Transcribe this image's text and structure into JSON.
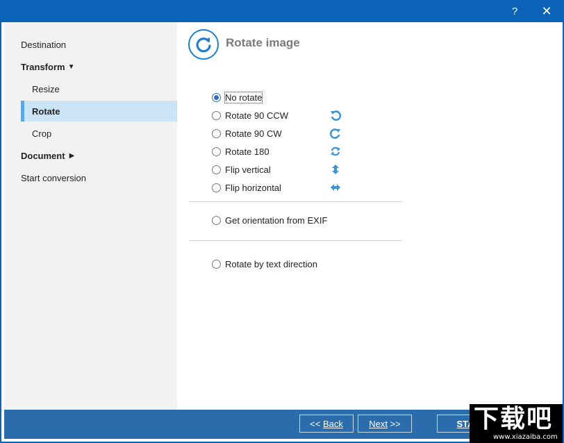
{
  "titlebar": {
    "help_glyph": "?",
    "close_glyph": "✕"
  },
  "sidebar": {
    "items": [
      {
        "label": "Destination",
        "bold": false
      },
      {
        "label": "Transform",
        "bold": true,
        "caret": "down"
      },
      {
        "label": "Resize",
        "sub": true
      },
      {
        "label": "Rotate",
        "sub": true,
        "active": true
      },
      {
        "label": "Crop",
        "sub": true
      },
      {
        "label": "Document",
        "bold": true,
        "caret": "right"
      },
      {
        "label": "Start conversion",
        "bold": false
      }
    ]
  },
  "header": {
    "title": "Rotate image",
    "icon": "rotate-cw-icon"
  },
  "options": [
    {
      "label": "No rotate",
      "checked": true
    },
    {
      "label": "Rotate 90 CCW",
      "icon": "rotate-ccw-icon"
    },
    {
      "label": "Rotate 90 CW",
      "icon": "rotate-cw-icon"
    },
    {
      "label": "Rotate 180",
      "icon": "rotate-180-icon"
    },
    {
      "label": "Flip vertical",
      "icon": "flip-vertical-icon"
    },
    {
      "label": "Flip horizontal",
      "icon": "flip-horizontal-icon"
    },
    {
      "label": "Get orientation from EXIF"
    },
    {
      "label": "Rotate by text direction"
    }
  ],
  "footer": {
    "back_prefix": "<< ",
    "back_label": "Back",
    "next_label": "Next",
    "next_suffix": " >>",
    "start_label": "STA"
  },
  "watermark": {
    "big": "下载吧",
    "small": "www.xiazaiba.com"
  },
  "colors": {
    "titlebar": "#0a63b6",
    "footer": "#2a6cac",
    "active_nav": "#cce4f7",
    "accent": "#1a7fd4"
  }
}
